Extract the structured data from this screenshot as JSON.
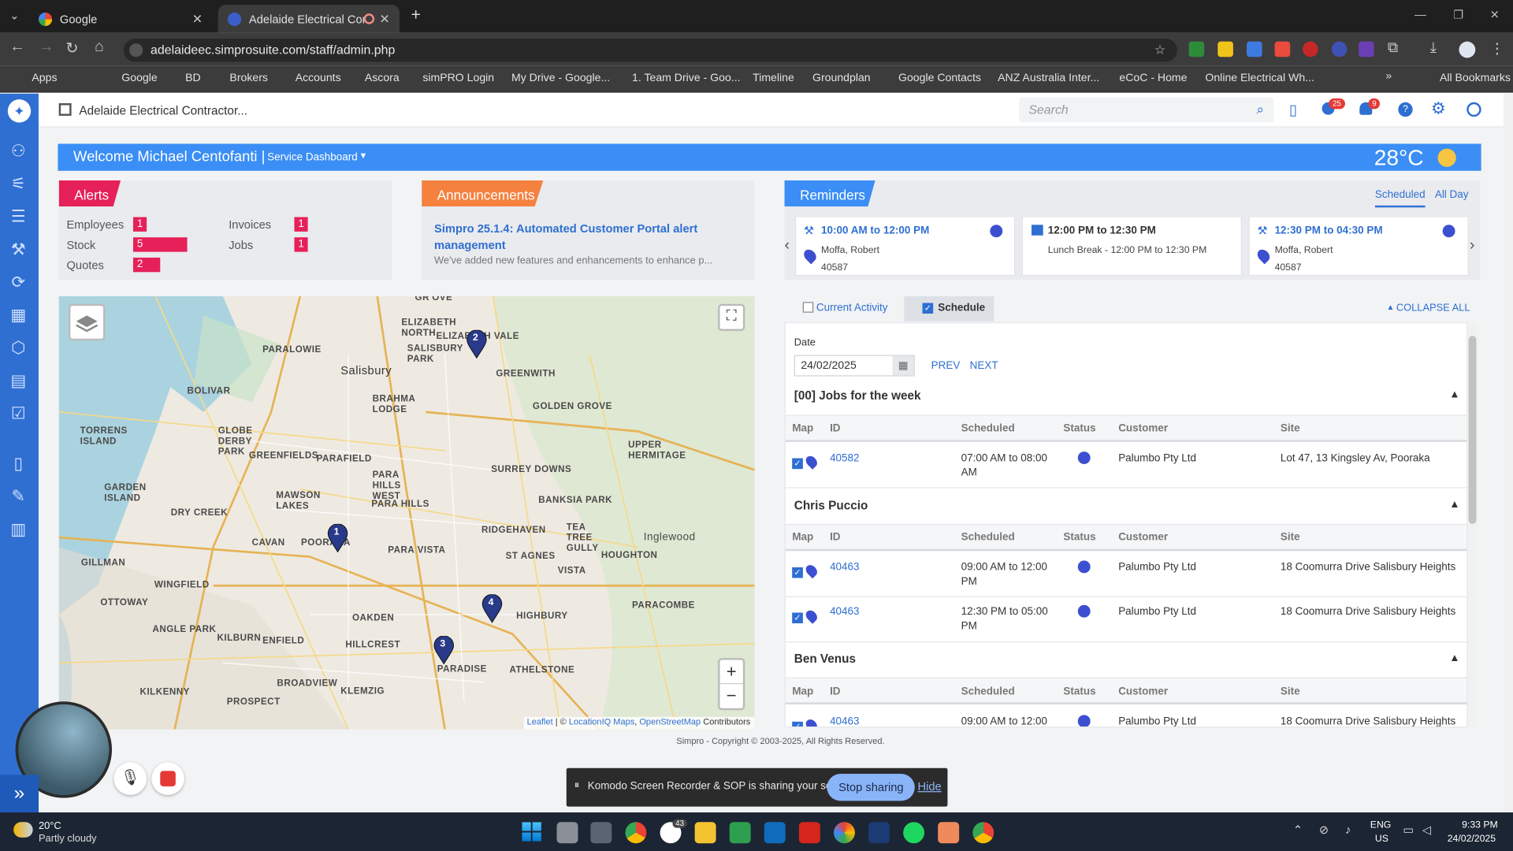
{
  "browser": {
    "tabs": [
      {
        "label": "Google"
      },
      {
        "label": "Adelaide Electrical Contract"
      }
    ],
    "url": "adelaideec.simprosuite.com/staff/admin.php",
    "bookmarks": [
      "Apps",
      "Google",
      "BD",
      "Brokers",
      "Accounts",
      "Ascora",
      "simPRO Login",
      "My Drive - Google...",
      "1. Team Drive - Goo...",
      "Timeline",
      "Groundplan",
      "Google Contacts",
      "ANZ Australia Inter...",
      "eCoC - Home",
      "Online Electrical Wh..."
    ],
    "all_bookmarks": "All Bookmarks"
  },
  "topbar": {
    "company": "Adelaide Electrical Contractor...",
    "search_placeholder": "Search",
    "badge_notifications": "25",
    "badge_alerts": "9"
  },
  "banner": {
    "welcome": "Welcome Michael Centofanti |",
    "dashboard": "Service Dashboard",
    "temperature": "28°C"
  },
  "alerts": {
    "title": "Alerts",
    "items": [
      {
        "label": "Employees",
        "count": "1",
        "fill": 0.25
      },
      {
        "label": "Invoices",
        "count": "1",
        "fill": 0.25
      },
      {
        "label": "Stock",
        "count": "5",
        "fill": 1.0
      },
      {
        "label": "Jobs",
        "count": "1",
        "fill": 0.25
      },
      {
        "label": "Quotes",
        "count": "2",
        "fill": 0.5
      }
    ]
  },
  "announcements": {
    "title": "Announcements",
    "headline": "Simpro 25.1.4: Automated Customer Portal alert management",
    "body": "We've added new features and enhancements to enhance p..."
  },
  "reminders": {
    "title": "Reminders",
    "tab_scheduled": "Scheduled",
    "tab_allday": "All Day",
    "cards": [
      {
        "time": "10:00 AM to 12:00 PM",
        "name": "Moffa, Robert",
        "job": "40587"
      },
      {
        "time": "12:00 PM to 12:30 PM",
        "name": "Lunch Break - 12:00 PM to 12:30 PM",
        "job": ""
      },
      {
        "time": "12:30 PM to 04:30 PM",
        "name": "Moffa, Robert",
        "job": "40587"
      }
    ]
  },
  "map": {
    "labels": [
      "GR'OVE",
      "ELIZABETH NORTH",
      "PARALOWIE",
      "Salisbury",
      "SALISBURY PARK",
      "ELIZABETH VALE",
      "GREENWITH",
      "BOLIVAR",
      "BRAHMA LODGE",
      "GOLDEN GROVE",
      "TORRENS ISLAND",
      "GLOBE DERBY PARK",
      "GREENFIELDS",
      "PARAFIELD",
      "UPPER HERMITAGE",
      "PARA HILLS WEST",
      "SURREY DOWNS",
      "GARDEN ISLAND",
      "MAWSON LAKES",
      "PARA HILLS",
      "BANKSIA PARK",
      "DRY CREEK",
      "RIDGEHAVEN",
      "TEA TREE GULLY",
      "Inglewood",
      "CAVAN",
      "POORAKA",
      "PARA VISTA",
      "ST AGNES",
      "HOUGHTON",
      "GILLMAN",
      "WINGFIELD",
      "VISTA",
      "OTTOWAY",
      "HIGHBURY",
      "PARACOMBE",
      "ANGLE PARK",
      "OAKDEN",
      "KILBURN",
      "ENFIELD",
      "HILLCREST",
      "PARADISE",
      "ATHELSTONE",
      "BROADVIEW",
      "KILKENNY",
      "KLEMZIG",
      "PROSPECT"
    ],
    "attribution_leaflet": "Leaflet",
    "attribution_sep": "| ©",
    "attribution_liq": "LocationIQ Maps",
    "attribution_osm": "OpenStreetMap",
    "attribution_tail": "Contributors",
    "pins": [
      "1",
      "2",
      "3",
      "4"
    ],
    "zoom_in": "+",
    "zoom_out": "−"
  },
  "schedule": {
    "tab_current": "Current Activity",
    "tab_schedule": "Schedule",
    "collapse": "COLLAPSE ALL",
    "date_label": "Date",
    "date_value": "24/02/2025",
    "prev": "PREV",
    "next": "NEXT",
    "headers": {
      "map": "Map",
      "id": "ID",
      "scheduled": "Scheduled",
      "status": "Status",
      "customer": "Customer",
      "site": "Site"
    },
    "groups": [
      {
        "title": "[00] Jobs for the week",
        "rows": [
          {
            "id": "40582",
            "time1": "07:00 AM to 08:00",
            "time2": "AM",
            "customer": "Palumbo Pty Ltd",
            "site": "Lot 47, 13 Kingsley Av, Pooraka"
          }
        ]
      },
      {
        "title": "Chris Puccio",
        "rows": [
          {
            "id": "40463",
            "time1": "09:00 AM to 12:00",
            "time2": "PM",
            "customer": "Palumbo Pty Ltd",
            "site": "18 Coomurra Drive Salisbury Heights"
          },
          {
            "id": "40463",
            "time1": "12:30 PM to 05:00",
            "time2": "PM",
            "customer": "Palumbo Pty Ltd",
            "site": "18 Coomurra Drive Salisbury Heights"
          }
        ]
      },
      {
        "title": "Ben Venus",
        "rows": [
          {
            "id": "40463",
            "time1": "09:00 AM to 12:00",
            "time2": "",
            "customer": "Palumbo Pty Ltd",
            "site": "18 Coomurra Drive Salisbury Heights"
          }
        ]
      }
    ]
  },
  "footer": "Simpro - Copyright © 2003-2025, All Rights Reserved.",
  "sharing": {
    "text": "Komodo Screen Recorder & SOP is sharing your screen.",
    "stop": "Stop sharing",
    "hide": "Hide"
  },
  "taskbar": {
    "weather_temp": "20°C",
    "weather_desc": "Partly cloudy",
    "lang1": "ENG",
    "lang2": "US",
    "time": "9:33 PM",
    "date": "24/02/2025",
    "badge": "43"
  },
  "colors": {
    "brand": "#2f6fd2",
    "alert": "#e62058",
    "announce": "#f5813f",
    "banner": "#3a8ef5"
  }
}
